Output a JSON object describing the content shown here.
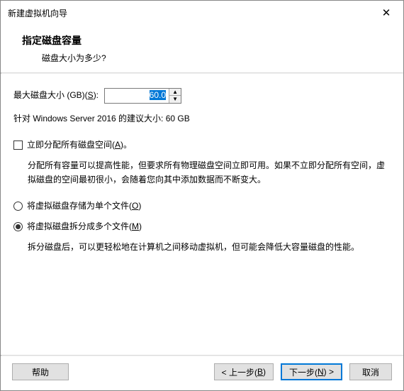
{
  "window": {
    "title": "新建虚拟机向导"
  },
  "header": {
    "title": "指定磁盘容量",
    "subtitle": "磁盘大小为多少?"
  },
  "disk": {
    "label_prefix": "最大磁盘大小 (GB)(",
    "label_key": "S",
    "label_suffix": "):",
    "value": "60.0",
    "recommend": "针对 Windows Server 2016 的建议大小: 60 GB"
  },
  "allocate": {
    "label_prefix": "立即分配所有磁盘空间(",
    "label_key": "A",
    "label_suffix": ")。",
    "checked": false,
    "desc": "分配所有容量可以提高性能，但要求所有物理磁盘空间立即可用。如果不立即分配所有空间，虚拟磁盘的空间最初很小，会随着您向其中添加数据而不断变大。"
  },
  "storage": {
    "single": {
      "label_prefix": "将虚拟磁盘存储为单个文件(",
      "label_key": "O",
      "label_suffix": ")",
      "selected": false
    },
    "split": {
      "label_prefix": "将虚拟磁盘拆分成多个文件(",
      "label_key": "M",
      "label_suffix": ")",
      "selected": true,
      "desc": "拆分磁盘后，可以更轻松地在计算机之间移动虚拟机，但可能会降低大容量磁盘的性能。"
    }
  },
  "buttons": {
    "help": "帮助",
    "back_prefix": "< 上一步(",
    "back_key": "B",
    "back_suffix": ")",
    "next_prefix": "下一步(",
    "next_key": "N",
    "next_suffix": ") >",
    "cancel": "取消"
  }
}
